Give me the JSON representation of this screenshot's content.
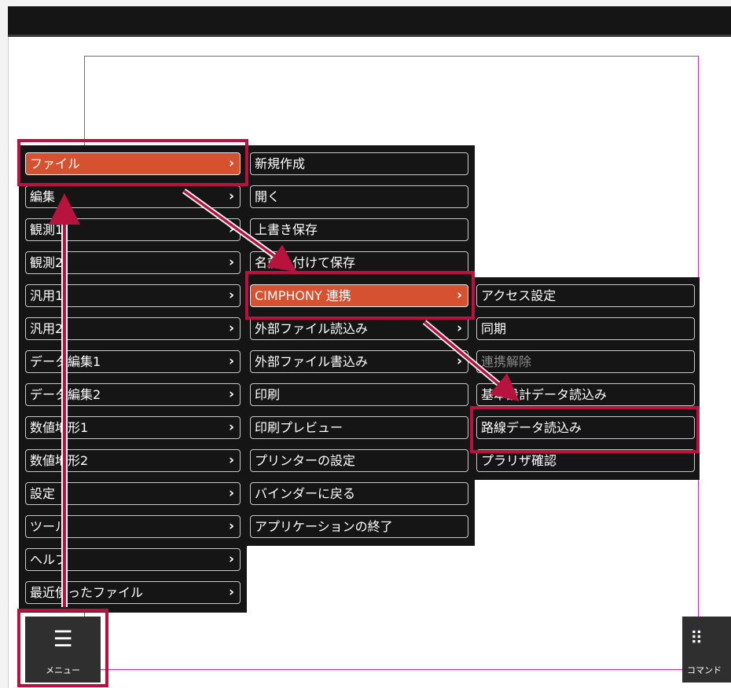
{
  "colors": {
    "active_item": "#d5512f",
    "highlight": "#b8123f",
    "canvas_border": "#e020e0",
    "menu_bg": "#151515"
  },
  "menu": {
    "items": [
      {
        "label": "ファイル"
      },
      {
        "label": "編集"
      },
      {
        "label": "観測1"
      },
      {
        "label": "観測2"
      },
      {
        "label": "汎用1"
      },
      {
        "label": "汎用2"
      },
      {
        "label": "データ編集1"
      },
      {
        "label": "データ編集2"
      },
      {
        "label": "数値地形1"
      },
      {
        "label": "数値地形2"
      },
      {
        "label": "設定"
      },
      {
        "label": "ツール"
      },
      {
        "label": "ヘルプ"
      },
      {
        "label": "最近使ったファイル"
      }
    ]
  },
  "file_menu": {
    "items": [
      {
        "label": "新規作成"
      },
      {
        "label": "開く"
      },
      {
        "label": "上書き保存"
      },
      {
        "label": "名前を付けて保存"
      },
      {
        "label": "CIMPHONY 連携"
      },
      {
        "label": "外部ファイル読込み"
      },
      {
        "label": "外部ファイル書込み"
      },
      {
        "label": "印刷"
      },
      {
        "label": "印刷プレビュー"
      },
      {
        "label": "プリンターの設定"
      },
      {
        "label": "バインダーに戻る"
      },
      {
        "label": "アプリケーションの終了"
      }
    ]
  },
  "cimphony_menu": {
    "items": [
      {
        "label": "アクセス設定"
      },
      {
        "label": "同期"
      },
      {
        "label": "連携解除"
      },
      {
        "label": "基本設計データ読込み"
      },
      {
        "label": "路線データ読込み"
      },
      {
        "label": "プラリザ確認"
      }
    ]
  },
  "chevron": "›",
  "toolbar": {
    "menu_button": {
      "label": "メニュー",
      "icon": "list-icon"
    },
    "command_button": {
      "label": "コマンド",
      "icon": "grid-dots-icon"
    }
  }
}
